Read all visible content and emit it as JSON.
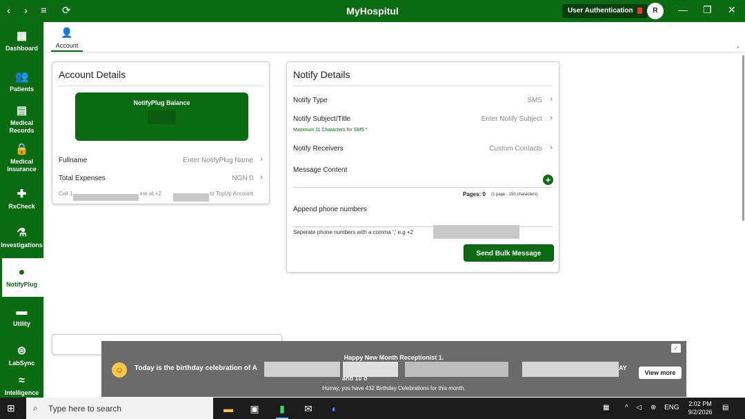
{
  "titlebar": {
    "app_title": "MyHospitul",
    "auth_label": "User Authentication",
    "avatar_initial": "R",
    "back_glyph": "‹",
    "forward_glyph": "›",
    "menu_glyph": "≡",
    "refresh_glyph": "⟳",
    "minimize_glyph": "—",
    "maximize_glyph": "❐",
    "close_glyph": "✕"
  },
  "sidebar": {
    "items": [
      {
        "label": "Dashboard",
        "icon": "▦"
      },
      {
        "label": "Patients",
        "icon": "👥"
      },
      {
        "label": "Medical Records",
        "icon": "▤"
      },
      {
        "label": "Medical Insurance",
        "icon": "🔒"
      },
      {
        "label": "RxCheck",
        "icon": "✚"
      },
      {
        "label": "Investigations",
        "icon": "⚗"
      },
      {
        "label": "NotifyPlug",
        "icon": "●"
      },
      {
        "label": "Utility",
        "icon": "▬"
      },
      {
        "label": "LabSync",
        "icon": "⊜"
      },
      {
        "label": "Intelligence",
        "icon": "≈"
      }
    ]
  },
  "subtab": {
    "label": "Account",
    "icon": "👤"
  },
  "account_details": {
    "title": "Account Details",
    "balance_label": "NotifyPlug Balance",
    "fullname_label": "Fullname",
    "fullname_placeholder": "Enter NotifyPlug Name",
    "expenses_label": "Total Expenses",
    "expenses_value": "NGN 0",
    "call_prefix": "Call 1",
    "call_mid": "ine at +2",
    "call_suffix": "to TopUp Account."
  },
  "notify_details": {
    "title": "Notify Details",
    "type_label": "Notify Type",
    "type_value": "SMS",
    "subject_label": "Notify Subject/Title",
    "subject_placeholder": "Enter Notify Subject",
    "subject_hint": "Maximum 11 Characters for SMS *",
    "receivers_label": "Notify Receivers",
    "receivers_value": "Custom Contacts",
    "message_label": "Message Content",
    "pages_label": "Pages: 0",
    "pages_hint": "(1 page - 150 characters)",
    "append_label": "Append phone numbers",
    "phone_placeholder": "Seperate phone numbers with a comma ',' e.g +2",
    "send_button": "Send Bulk Message"
  },
  "toast": {
    "line1": "Happy New Month Receptionist 1.",
    "line2": "Today is the birthday celebration of A",
    "line2_tail": "AY",
    "line3": "and 10 o",
    "line4": "Hurray, you have 432 Birthday Celebrations for this month.",
    "view_more": "View more",
    "close_glyph": "✓"
  },
  "taskbar": {
    "search_placeholder": "Type here to search",
    "language": "ENG",
    "time": "2:02 PM",
    "date": "9/2/2026"
  }
}
